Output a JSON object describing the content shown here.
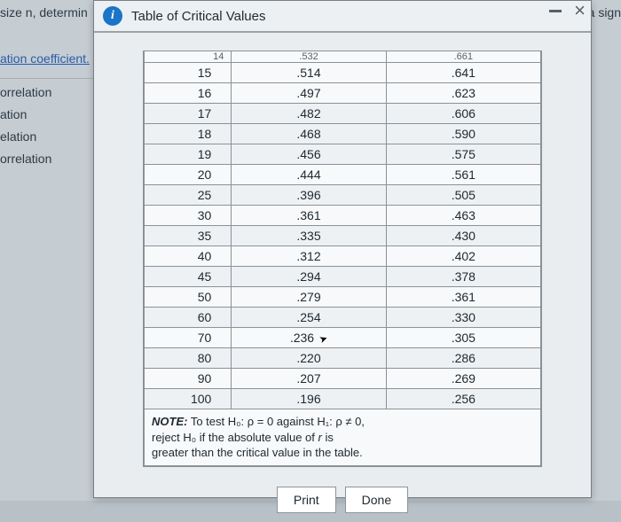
{
  "background": {
    "top_left": "size n, determin",
    "top_right": "ven r represents a sign",
    "link": "ation coefficient.",
    "side1": "orrelation",
    "side2": "ation",
    "side3": "elation",
    "side4": "orrelation"
  },
  "dialog": {
    "info_glyph": "i",
    "title": "Table of Critical Values",
    "minimize": "–",
    "close": "×"
  },
  "table": {
    "frag1": "14",
    "frag2": ".532",
    "frag3": ".661",
    "rows": [
      {
        "n": "15",
        "a": ".514",
        "b": ".641",
        "shade": false
      },
      {
        "n": "16",
        "a": ".497",
        "b": ".623",
        "shade": false
      },
      {
        "n": "17",
        "a": ".482",
        "b": ".606",
        "shade": true
      },
      {
        "n": "18",
        "a": ".468",
        "b": ".590",
        "shade": true
      },
      {
        "n": "19",
        "a": ".456",
        "b": ".575",
        "shade": true
      },
      {
        "n": "20",
        "a": ".444",
        "b": ".561",
        "shade": false
      },
      {
        "n": "25",
        "a": ".396",
        "b": ".505",
        "shade": true
      },
      {
        "n": "30",
        "a": ".361",
        "b": ".463",
        "shade": false
      },
      {
        "n": "35",
        "a": ".335",
        "b": ".430",
        "shade": true
      },
      {
        "n": "40",
        "a": ".312",
        "b": ".402",
        "shade": false
      },
      {
        "n": "45",
        "a": ".294",
        "b": ".378",
        "shade": true
      },
      {
        "n": "50",
        "a": ".279",
        "b": ".361",
        "shade": false
      },
      {
        "n": "60",
        "a": ".254",
        "b": ".330",
        "shade": true
      },
      {
        "n": "70",
        "a": ".236",
        "b": ".305",
        "shade": false,
        "cursor": true
      },
      {
        "n": "80",
        "a": ".220",
        "b": ".286",
        "shade": true
      },
      {
        "n": "90",
        "a": ".207",
        "b": ".269",
        "shade": false
      },
      {
        "n": "100",
        "a": ".196",
        "b": ".256",
        "shade": true
      }
    ],
    "note_html": "NOTE: To test H₀: ρ = 0 against H₁: ρ ≠ 0, reject H₀ if the absolute value of r is greater than the critical value in the table.",
    "note_label": "NOTE:",
    "note_l1": " To test H₀: ρ = 0 against H₁: ρ ≠ 0,",
    "note_l2": "reject H₀ if the absolute value of ",
    "note_r": "r",
    "note_l2b": " is",
    "note_l3": "greater than the critical value in the table."
  },
  "buttons": {
    "print": "Print",
    "done": "Done"
  }
}
